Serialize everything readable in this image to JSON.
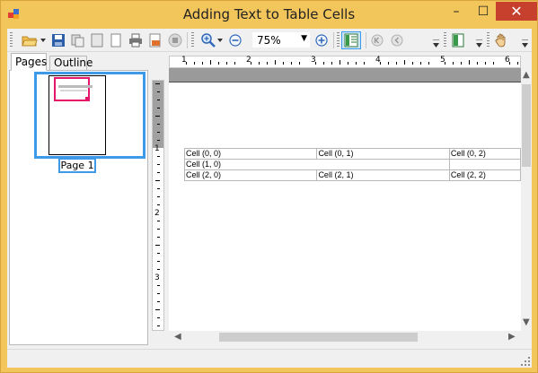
{
  "window": {
    "title": "Adding Text to Table Cells",
    "controls": {
      "minimize": "–",
      "maximize": "☐",
      "close": "✕"
    }
  },
  "toolbar": {
    "zoom": {
      "value": "75%"
    },
    "icons": [
      "open-folder-icon",
      "save-icon",
      "copy-pages-icon",
      "single-page-icon",
      "multi-page-icon",
      "print-icon",
      "page-setup-icon",
      "stop-icon",
      "zoom-in-icon",
      "zoom-out-icon",
      "zoom-plus-icon",
      "thumbnails-toggle-icon",
      "first-page-icon",
      "previous-page-icon",
      "page-layout-icon",
      "hand-tool-icon"
    ]
  },
  "left_panel": {
    "tabs": [
      {
        "label": "Pages",
        "active": true
      },
      {
        "label": "Outline",
        "active": false
      }
    ],
    "thumbnails": [
      {
        "label": "Page 1",
        "selected": true
      }
    ]
  },
  "ruler": {
    "horizontal": [
      "1",
      "2",
      "3",
      "4",
      "5",
      "6"
    ],
    "vertical": [
      "1",
      "2",
      "3"
    ]
  },
  "document": {
    "table": [
      [
        "Cell (0, 0)",
        "Cell (0, 1)",
        "Cell (0, 2)"
      ],
      [
        "Cell (1, 0)",
        "",
        ""
      ],
      [
        "Cell (2, 0)",
        "Cell (2, 1)",
        "Cell (2, 2)"
      ]
    ]
  },
  "colors": {
    "frame": "#f3c65b",
    "close_button": "#c7402d",
    "selection": "#3d9ae8",
    "thumbnail_marker": "#e4176b"
  }
}
